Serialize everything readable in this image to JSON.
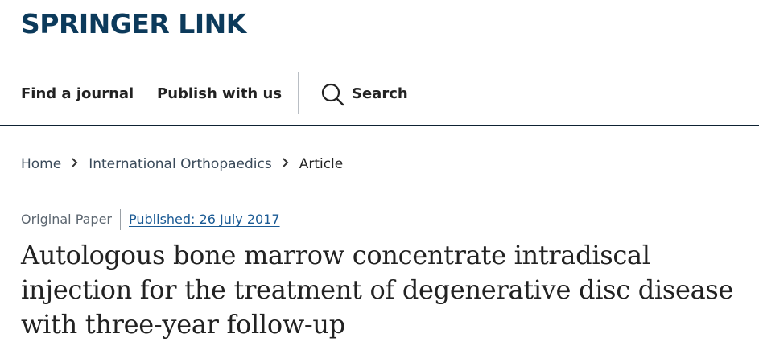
{
  "header": {
    "logo_text": "SPRINGER LINK",
    "brand_color": "#0c3a5b"
  },
  "nav": {
    "find_journal": "Find a journal",
    "publish": "Publish with us",
    "search_label": "Search",
    "search_icon": "search-icon"
  },
  "breadcrumb": {
    "items": [
      "Home",
      "International Orthopaedics",
      "Article"
    ],
    "separator": "›"
  },
  "article": {
    "type": "Original Paper",
    "published": "Published: 26 July 2017",
    "title_lines": [
      "Autologous bone marrow concentrate intradiscal",
      "injection for the treatment of degenerative disc disease",
      "with three-year follow-up"
    ],
    "link_color": "#1a5a94"
  }
}
